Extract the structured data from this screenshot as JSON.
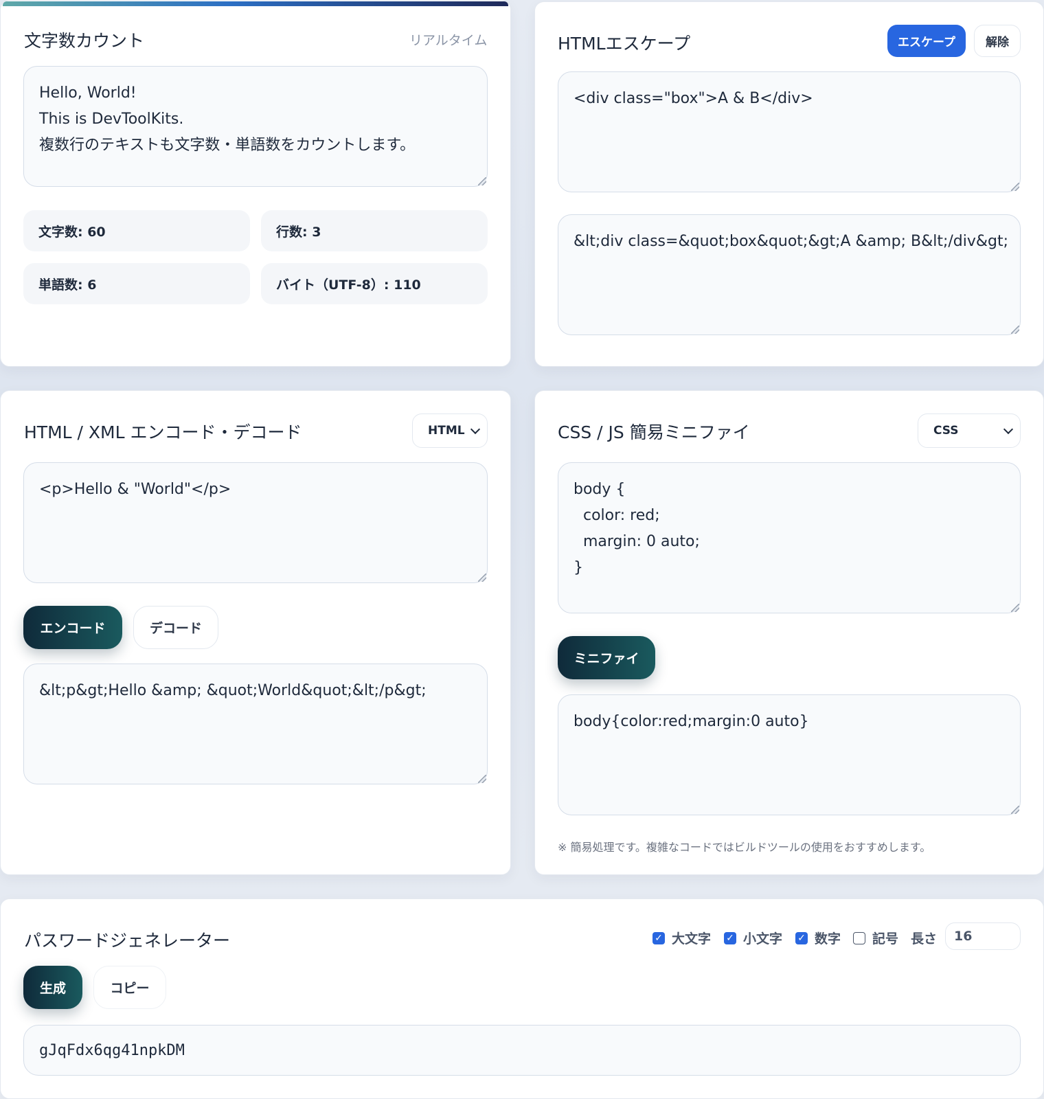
{
  "char_count": {
    "title": "文字数カウント",
    "mode": "リアルタイム",
    "input": "Hello, World!\nThis is DevToolKits.\n複数行のテキストも文字数・単語数をカウントします。",
    "stats": {
      "chars": "文字数: 60",
      "lines": "行数: 3",
      "words": "単語数: 6",
      "bytes": "バイト（UTF-8）: 110"
    }
  },
  "html_escape": {
    "title": "HTMLエスケープ",
    "escape_label": "エスケープ",
    "unescape_label": "解除",
    "input": "<div class=\"box\">A & B</div>",
    "output": "&lt;div class=&quot;box&quot;&gt;A &amp; B&lt;/div&gt;"
  },
  "encode_decode": {
    "title": "HTML / XML エンコード・デコード",
    "format_selected": "HTML",
    "input": "<p>Hello & \"World\"</p>",
    "encode_label": "エンコード",
    "decode_label": "デコード",
    "output": "&lt;p&gt;Hello &amp; &quot;World&quot;&lt;/p&gt;"
  },
  "minify": {
    "title": "CSS / JS 簡易ミニファイ",
    "lang_selected": "CSS",
    "input": "body {\n  color: red;\n  margin: 0 auto;\n}",
    "minify_label": "ミニファイ",
    "output": "body{color:red;margin:0 auto}",
    "note": "※ 簡易処理です。複雑なコードではビルドツールの使用をおすすめします。"
  },
  "password": {
    "title": "パスワードジェネレーター",
    "options": {
      "upper": {
        "label": "大文字",
        "checked": true
      },
      "lower": {
        "label": "小文字",
        "checked": true
      },
      "digits": {
        "label": "数字",
        "checked": true
      },
      "symbols": {
        "label": "記号",
        "checked": false
      }
    },
    "length_label": "長さ",
    "length_value": "16",
    "generate_label": "生成",
    "copy_label": "コピー",
    "output": "gJqFdx6qg41npkDM"
  },
  "colors": {
    "accent_blue": "#2866e0",
    "button_dark": "#0f2a3a",
    "button_teal": "#1a5a5e"
  }
}
